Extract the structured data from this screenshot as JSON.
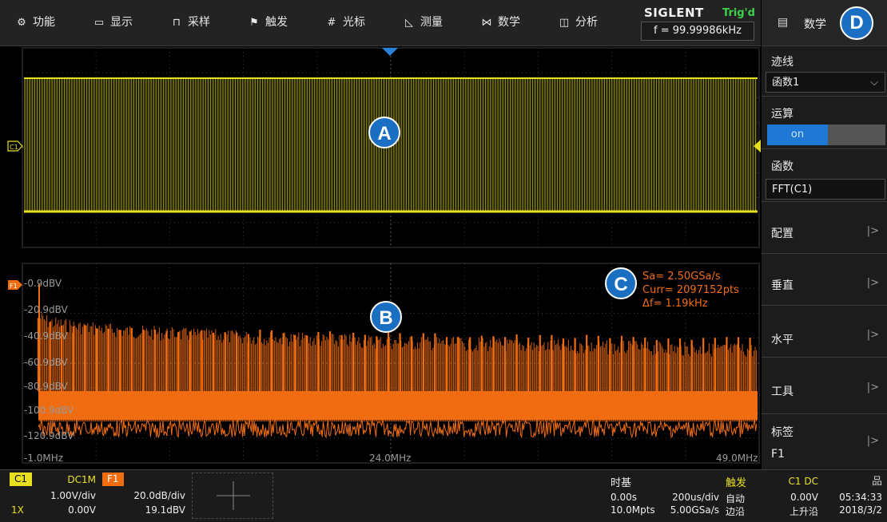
{
  "menu": {
    "items": [
      {
        "icon": "gear-icon",
        "glyph": "⚙",
        "label": "功能"
      },
      {
        "icon": "display-icon",
        "glyph": "▭",
        "label": "显示"
      },
      {
        "icon": "acquire-icon",
        "glyph": "⊓",
        "label": "采样"
      },
      {
        "icon": "flag-icon",
        "glyph": "⚑",
        "label": "触发"
      },
      {
        "icon": "cursor-icon",
        "glyph": "#",
        "label": "光标"
      },
      {
        "icon": "measure-icon",
        "glyph": "◺",
        "label": "测量"
      },
      {
        "icon": "math-icon",
        "glyph": "⋈",
        "label": "数学"
      },
      {
        "icon": "analysis-icon",
        "glyph": "◫",
        "label": "分析"
      }
    ]
  },
  "brand": {
    "name": "SIGLENT",
    "trigger_status": "Trig'd",
    "frequency": "f = 99.99986kHz"
  },
  "callouts": {
    "a": "A",
    "b": "B",
    "c": "C",
    "d": "D"
  },
  "right_panel": {
    "title": "数学",
    "trace_label": "迹线",
    "trace_value": "函数1",
    "operation_label": "运算",
    "operation_state": "on",
    "function_label": "函数",
    "function_value": "FFT(C1)",
    "items": [
      "配置",
      "垂直",
      "水平",
      "工具"
    ],
    "arrow": "|>",
    "label_title": "标签",
    "label_value": "F1"
  },
  "fft_info": {
    "sample_rate": "Sa= 2.50GSa/s",
    "points": "Curr= 2097152pts",
    "resolution": "Δf= 1.19kHz"
  },
  "fft_axis": {
    "y_labels": [
      "-0.9dBV",
      "-20.9dBV",
      "-40.9dBV",
      "-60.9dBV",
      "-80.9dBV",
      "-100.9dBV",
      "-120.9dBV"
    ],
    "x_labels": [
      "-1.0MHz",
      "24.0MHz",
      "49.0MHz"
    ]
  },
  "markers": {
    "c1": "C1",
    "f1": "F1"
  },
  "status": {
    "c1": {
      "tag": "C1",
      "coupling": "DC1M",
      "scale": "1.00V/div",
      "probe": "1X",
      "offset": "0.00V"
    },
    "f1": {
      "tag": "F1",
      "scale": "20.0dB/div",
      "offset": "19.1dBV"
    },
    "timebase": {
      "title": "时基",
      "delay": "0.00s",
      "scale": "200us/div",
      "memory": "10.0Mpts",
      "rate": "5.00GSa/s"
    },
    "trigger": {
      "title": "触发",
      "source": "C1 DC",
      "mode": "自动",
      "level": "0.00V",
      "type": "边沿",
      "slope": "上升沿"
    },
    "clock": {
      "time": "05:34:33",
      "date": "2018/3/2"
    }
  },
  "colors": {
    "c1": "#e8e01e",
    "f1": "#f06d12",
    "accent": "#1e78d4",
    "grid": "#3a3a3a"
  }
}
